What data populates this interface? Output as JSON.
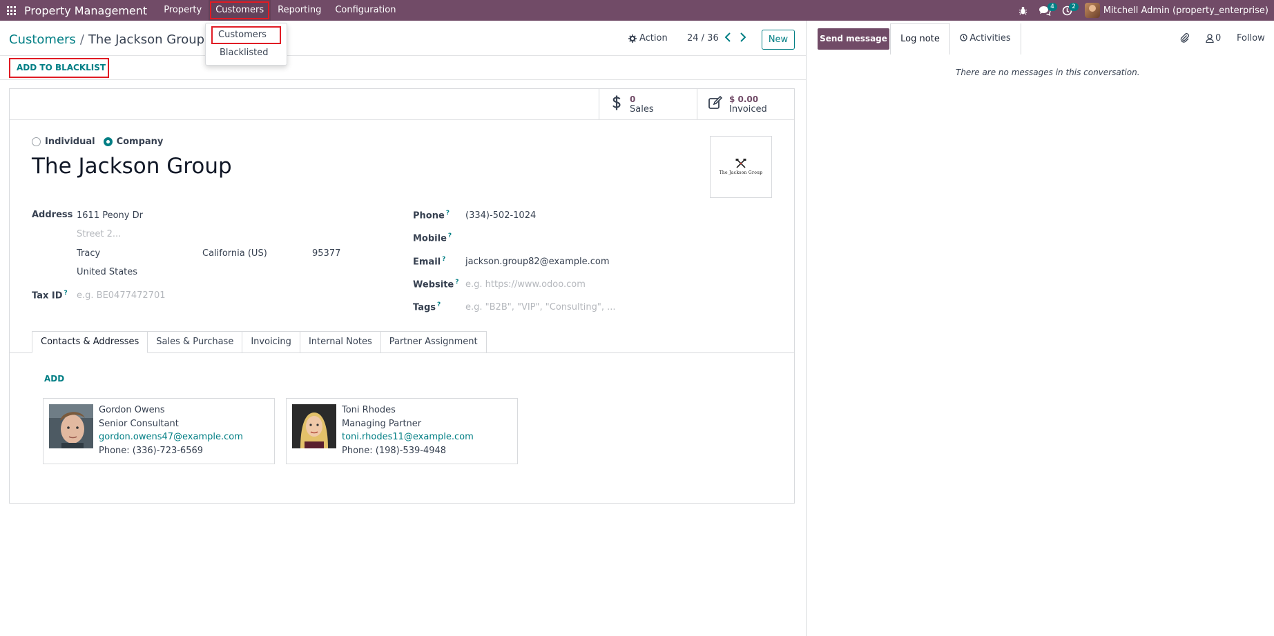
{
  "navbar": {
    "app_name": "Property Management",
    "menu": [
      "Property",
      "Customers",
      "Reporting",
      "Configuration"
    ],
    "active_menu": "Customers",
    "messages_badge": "4",
    "activities_badge": "2",
    "user": "Mitchell Admin (property_enterprise)",
    "icons": [
      "apps-grid-icon",
      "bug-icon",
      "chat-icon",
      "clock-icon"
    ]
  },
  "dropdown": {
    "items": [
      "Customers",
      "Blacklisted"
    ],
    "selected": "Customers"
  },
  "breadcrumb": {
    "parent": "Customers",
    "separator": "/",
    "current": "The Jackson Group"
  },
  "control": {
    "action_label": "Action",
    "pager": "24 / 36",
    "new_label": "New",
    "blacklist_label": "ADD TO BLACKLIST"
  },
  "stats": {
    "sales_value": "0",
    "sales_label": "Sales",
    "invoiced_value": "$ 0.00",
    "invoiced_label": "Invoiced"
  },
  "form": {
    "type_options": [
      "Individual",
      "Company"
    ],
    "type_selected": "Company",
    "name": "The Jackson Group",
    "logo_text": "The Jackson Group",
    "address_label": "Address",
    "street": "1611 Peony Dr",
    "street2_placeholder": "Street 2...",
    "city": "Tracy",
    "state": "California (US)",
    "zip": "95377",
    "country": "United States",
    "taxid_label": "Tax ID",
    "taxid_placeholder": "e.g. BE0477472701",
    "phone_label": "Phone",
    "phone": "(334)-502-1024",
    "mobile_label": "Mobile",
    "mobile": "",
    "email_label": "Email",
    "email": "jackson.group82@example.com",
    "website_label": "Website",
    "website_placeholder": "e.g. https://www.odoo.com",
    "tags_label": "Tags",
    "tags_placeholder": "e.g. \"B2B\", \"VIP\", \"Consulting\", ...",
    "help_mark": "?"
  },
  "tabs": {
    "items": [
      "Contacts & Addresses",
      "Sales & Purchase",
      "Invoicing",
      "Internal Notes",
      "Partner Assignment"
    ],
    "active": "Contacts & Addresses"
  },
  "contacts": {
    "add_label": "ADD",
    "cards": [
      {
        "name": "Gordon Owens",
        "title": "Senior Consultant",
        "email": "gordon.owens47@example.com",
        "phone": "Phone: (336)-723-6569"
      },
      {
        "name": "Toni Rhodes",
        "title": "Managing Partner",
        "email": "toni.rhodes11@example.com",
        "phone": "Phone: (198)-539-4948"
      }
    ]
  },
  "chatter": {
    "send_message": "Send message",
    "log_note": "Log note",
    "activities": "Activities",
    "followers_count": "0",
    "follow_label": "Follow",
    "empty_text": "There are no messages in this conversation."
  },
  "colors": {
    "brand": "#714b67",
    "accent": "#017e84",
    "highlight": "#e01b24"
  }
}
